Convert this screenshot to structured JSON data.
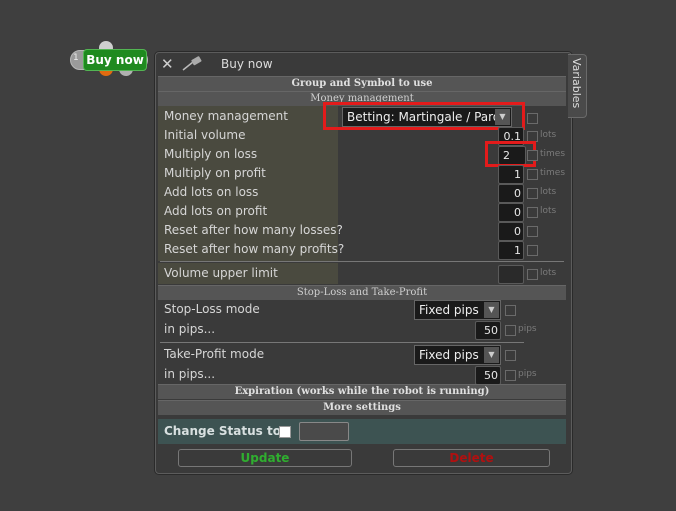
{
  "node": {
    "index": "1",
    "label": "Buy now"
  },
  "window": {
    "title": "Buy now",
    "side_tab": "Variables"
  },
  "sections": {
    "group_symbol": "Group and Symbol to use",
    "money_management": "Money management",
    "stop_loss": "Stop-Loss and Take-Profit",
    "expiration": "Expiration (works while the robot is running)",
    "more_settings": "More settings"
  },
  "money": {
    "mode_label": "Money management",
    "mode_value": "Betting: Martingale / Paroli",
    "rows": [
      {
        "label": "Initial volume",
        "value": "0.1",
        "unit": "lots"
      },
      {
        "label": "Multiply on loss",
        "value": "2",
        "unit": "times"
      },
      {
        "label": "Multiply on profit",
        "value": "1",
        "unit": "times"
      },
      {
        "label": "Add lots on loss",
        "value": "0",
        "unit": "lots"
      },
      {
        "label": "Add lots on profit",
        "value": "0",
        "unit": "lots"
      },
      {
        "label": "Reset after how many losses?",
        "value": "0",
        "unit": ""
      },
      {
        "label": "Reset after how many profits?",
        "value": "1",
        "unit": ""
      }
    ],
    "upper_limit_label": "Volume upper limit",
    "upper_limit_value": "",
    "upper_limit_unit": "lots"
  },
  "stoploss": {
    "sl_mode_label": "Stop-Loss mode",
    "sl_mode_value": "Fixed pips",
    "sl_pips_label": "in pips...",
    "sl_pips_value": "50",
    "sl_unit": "pips",
    "tp_mode_label": "Take-Profit mode",
    "tp_mode_value": "Fixed pips",
    "tp_pips_label": "in pips...",
    "tp_pips_value": "50",
    "tp_unit": "pips"
  },
  "status": {
    "label": "Change Status to",
    "value": ""
  },
  "buttons": {
    "update": "Update",
    "delete": "Delete"
  },
  "colors": {
    "highlight": "#e31b1b",
    "update": "#2fae2f",
    "delete": "#b01010"
  },
  "icons": {
    "close": "close-icon",
    "pin": "pin-icon",
    "dropdown": "chevron-down-icon"
  }
}
